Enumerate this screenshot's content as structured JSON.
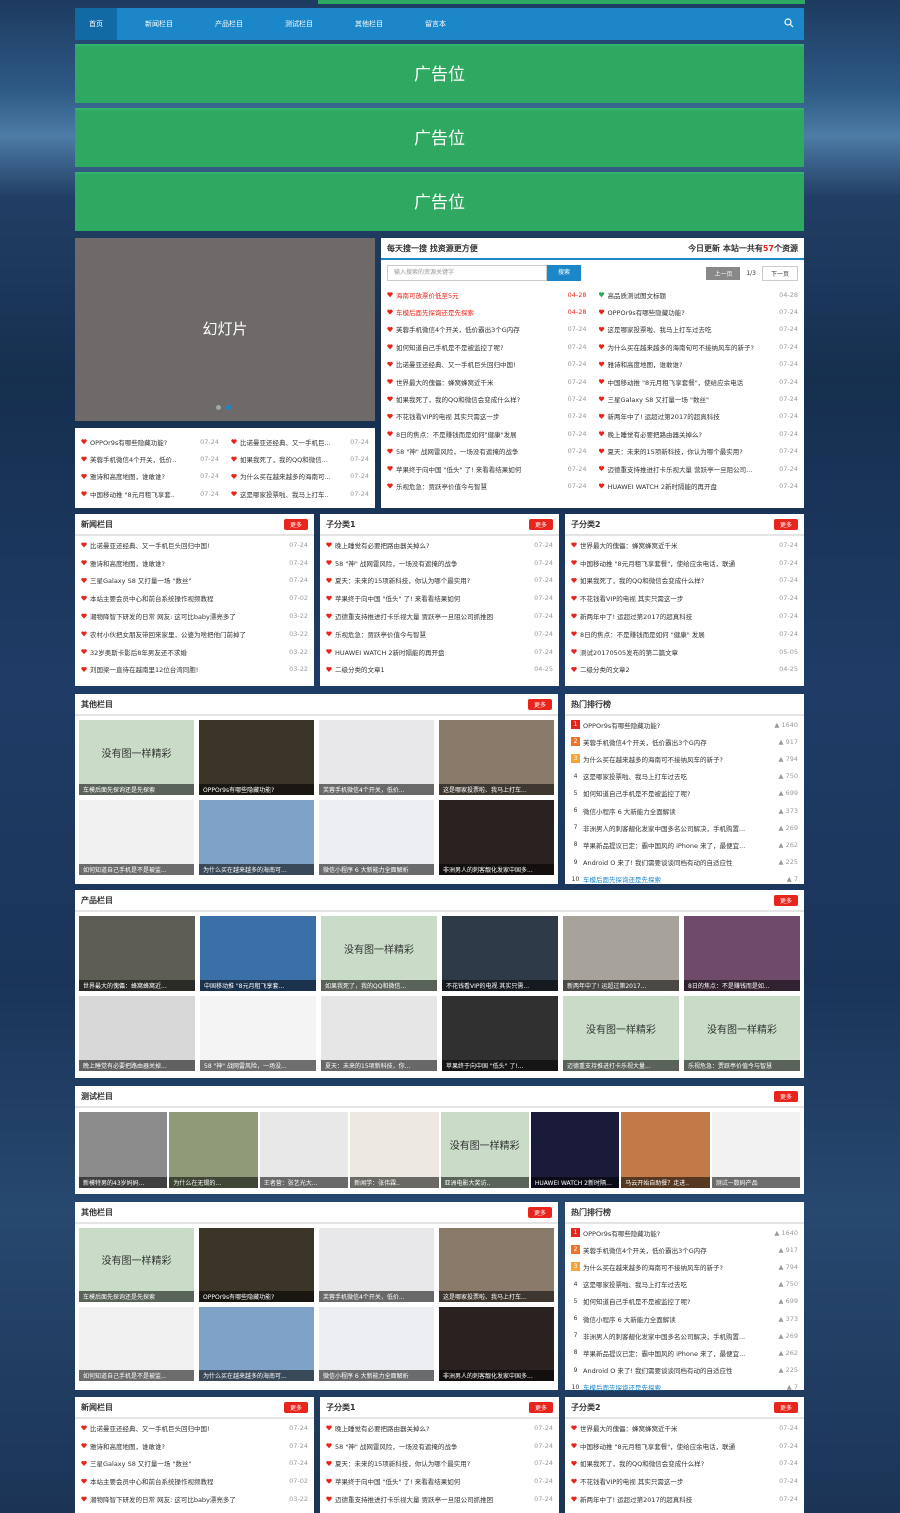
{
  "nav": {
    "items": [
      "首页",
      "新闻栏目",
      "产品栏目",
      "测试栏目",
      "其他栏目",
      "留言本"
    ]
  },
  "ads": [
    "广告位",
    "广告位",
    "广告位"
  ],
  "slider": {
    "label": "幻灯片"
  },
  "search": {
    "title": "每天搜一搜 找资源更方便",
    "today_prefix": "今日更新 本站一共有",
    "count": "57",
    "today_suffix": "个资源",
    "placeholder": "输入搜索的资源关键字",
    "button": "搜索",
    "page_prev": "上一页",
    "page_info": "1/3",
    "page_next": "下一页",
    "left": [
      [
        "海南可放票价低至5元",
        "04-28"
      ],
      [
        "车模后面先探询还是先探索",
        "04-28"
      ],
      [
        "芙蓉手机微信4个开关，低价霸出3个G内存",
        "07-24"
      ],
      [
        "如何知道自己手机是不是被监控了呢?",
        "07-24"
      ],
      [
        "比诺曼亚还经典、又一手机巨头回归中国!",
        "07-24"
      ],
      [
        "世界最大的傀儡：蜂窝蜂窝近千米",
        "07-24"
      ],
      [
        "如果我死了，我的QQ和微信会变成什么样?",
        "07-24"
      ],
      [
        "不花钱看VIP的电视 其实只需这一步",
        "07-24"
      ],
      [
        "8日的焦点：不是赚钱而是如何\"健康\"发展",
        "07-24"
      ],
      [
        "58 \"神\" 战网雷风险，一场没有遮掩的战争",
        "07-24"
      ],
      [
        "苹果终于向中国 \"低头\" 了! 来看看结果如何",
        "07-24"
      ],
      [
        "乐视危急：贾跃亭价值今与智慧",
        "07-24"
      ]
    ],
    "right": [
      [
        "高品质测试图文标题",
        "04-28"
      ],
      [
        "OPPOr9s有哪些隐藏功能?",
        "07-24"
      ],
      [
        "这是哪家投票啦、我马上打车过去吃",
        "07-24"
      ],
      [
        "为什么买在越来越多的海南旬可不接纳风车的新子?",
        "07-24"
      ],
      [
        "雅诗和高度地图，谁敢谁?",
        "07-24"
      ],
      [
        "中国移动推 \"8元月租飞享套餐\"，使给应余电话",
        "07-24"
      ],
      [
        "三星Galaxy S8 又打量一场 \"数丝\"",
        "07-24"
      ],
      [
        "新两年中了! 运超过第2017的超真科技",
        "07-24"
      ],
      [
        "晚上睡觉有必要把路由器关掉么?",
        "07-24"
      ],
      [
        "夏天：未来的15项新科技，你认为哪个最实用?",
        "07-24"
      ],
      [
        "迈德重支持推进打卡乐视大量 营跃亭一旦阻公司...",
        "07-24"
      ],
      [
        "HUAWEI WATCH 2新时隔能的再开盘",
        "07-24"
      ]
    ]
  },
  "mini": {
    "a": [
      [
        "OPPOr9s有哪些隐藏功能?",
        "07-24"
      ],
      [
        "芙蓉手机微信4个开关，低价..",
        "07-24"
      ],
      [
        "雅诗和高度地图，谁敢谁?",
        "07-24"
      ],
      [
        "中国移动推 \"8元月租飞享套..",
        "07-24"
      ]
    ],
    "b": [
      [
        "比诺曼亚还经典、又一手机巨...",
        "07-24"
      ],
      [
        "如果我死了，我的QQ和微信...",
        "07-24"
      ],
      [
        "为什么买在越来越多的海南可...",
        "07-24"
      ],
      [
        "这是哪家投票啦、我马上打车..",
        "07-24"
      ]
    ]
  },
  "more": "更多",
  "sec1": {
    "title": "新闻栏目",
    "items": [
      [
        "比诺曼亚还经典、又一手机巨头回归中国!",
        "07-24"
      ],
      [
        "雅诗和高度地图，谁敢谁?",
        "07-24"
      ],
      [
        "三星Galaxy S8 又打量一场 \"数丝\"",
        "07-24"
      ],
      [
        "本站主要会员中心和前台系统操作视频教程",
        "07-02"
      ],
      [
        "潮物降智下研发的日常 网友: 这可比baby漂亮多了",
        "03-22"
      ],
      [
        "农村小伙把女朋友带回来家里，公婆为啥把他门前掉了",
        "03-22"
      ],
      [
        "32岁奥斯卡影后8年男友还不求婚",
        "03-22"
      ],
      [
        "刘国梁一直待在越南里12位台湾同胞!",
        "03-22"
      ]
    ]
  },
  "sec2": {
    "title": "子分类1",
    "items": [
      [
        "晚上睡觉有必要把路由器关掉么?",
        "07-24"
      ],
      [
        "58 \"神\" 战网雷风险，一场没有遮掩的战争",
        "07-24"
      ],
      [
        "夏天：未来的15项新科技，你认为哪个最实用?",
        "07-24"
      ],
      [
        "苹果终于向中国 \"低头\" 了! 来看看结果如何",
        "07-24"
      ],
      [
        "迈德重支持推进打卡乐视大量 贾跃亭一旦阻公司抓推困",
        "07-24"
      ],
      [
        "乐视危急：贾跃亭价值今与智慧",
        "07-24"
      ],
      [
        "HUAWEI WATCH 2新时隔能的再开盘",
        "07-24"
      ],
      [
        "二级分类的文章1",
        "04-25"
      ]
    ]
  },
  "sec3": {
    "title": "子分类2",
    "items": [
      [
        "世界最大的傀儡：蜂窝蜂窝近千米",
        "07-24"
      ],
      [
        "中国移动推 \"8元月租飞享套餐\"，使给应余电话，联通",
        "07-24"
      ],
      [
        "如果我死了，我的QQ和微信会变成什么样?",
        "07-24"
      ],
      [
        "不花钱看VIP的电视 其实只需这一步",
        "07-24"
      ],
      [
        "新两年中了! 运超过第2017的超真科技",
        "07-24"
      ],
      [
        "8日的焦点：不是赚钱而是如何 \"健康\" 发展",
        "07-24"
      ],
      [
        "测试20170505发布的第二篇文章",
        "05-05"
      ],
      [
        "二级分类的文章2",
        "04-25"
      ]
    ]
  },
  "other": {
    "title": "其他栏目",
    "thumbs": [
      {
        "ph": "没有图一样精彩",
        "cap": "车模后面先探询还是先探索",
        "bg": "#c8dcc8"
      },
      {
        "cap": "OPPOr9s有哪些隐藏功能?",
        "bg": "#3b3428"
      },
      {
        "cap": "芙蓉手机微信4个开关，低价...",
        "bg": "#e8e8ea"
      },
      {
        "cap": "这是哪家投票啦、我马上打车...",
        "bg": "#8a7a6a"
      },
      {
        "cap": "如何知道自己手机是不是被监...",
        "bg": "#f0f0f0"
      },
      {
        "cap": "为什么买在越来越多的海南可...",
        "bg": "#7fa3c8"
      },
      {
        "cap": "微信小程序 6 大新能力全面解析",
        "bg": "#eceef2"
      },
      {
        "cap": "非洲男人的刺客靓化发家中国多...",
        "bg": "#2a2220"
      }
    ]
  },
  "rank": {
    "title": "热门排行榜",
    "items": [
      [
        "OPPOr9s有哪些隐藏功能?",
        "1640"
      ],
      [
        "芙蓉手机微信4个开关，低价霸出3个G内存",
        "917"
      ],
      [
        "为什么买在越来越多的海南可不接纳风车的新子?",
        "794"
      ],
      [
        "这是哪家投票啦、我马上打车过去吃",
        "750"
      ],
      [
        "如何知道自己手机是不是被监控了呢?",
        "699"
      ],
      [
        "微信小程序 6 大新能力全面解读",
        "373"
      ],
      [
        "非洲男人的刺客靓化发家中国多名公司解决，手机购置...",
        "269"
      ],
      [
        "苹果新品提议已定：霸中国风的 iPhone 来了，最便宜...",
        "262"
      ],
      [
        "Android O 来了! 我们需要谈谈同档有动的自适应性",
        "225"
      ],
      [
        "车模后面先探询还是先探索",
        "7"
      ]
    ]
  },
  "product": {
    "title": "产品栏目",
    "thumbs": [
      {
        "cap": "世界最大的傀儡：蜂窝蜂窝近...",
        "bg": "#5d5d55"
      },
      {
        "cap": "中国移动推 \"8元月租飞享套...",
        "bg": "#3a6fa8"
      },
      {
        "ph": "没有图一样精彩",
        "cap": "如果我死了，我的QQ和微信...",
        "bg": "#c8dcc8"
      },
      {
        "cap": "不花钱看VIP的电视 其实只需...",
        "bg": "#2f3a48"
      },
      {
        "cap": "新两年中了! 运超过第2017...",
        "bg": "#a7a39a"
      },
      {
        "cap": "8日的焦点：不是赚钱而是如...",
        "bg": "#6f4a6a"
      },
      {
        "cap": "晚上睡觉有必要把路由器关掉...",
        "bg": "#d8d8d8"
      },
      {
        "cap": "58 \"神\" 战网雷风险，一场没...",
        "bg": "#f4f4f4"
      },
      {
        "cap": "夏天：未来的15项新科技，你...",
        "bg": "#e6e6e6"
      },
      {
        "cap": "苹果终于向中国 \"低头\" 了!...",
        "bg": "#303030"
      },
      {
        "ph": "没有图一样精彩",
        "cap": "迈德重支持推进打卡乐视大量...",
        "bg": "#c8dcc8"
      },
      {
        "ph": "没有图一样精彩",
        "cap": "乐视危急：贾跃亭价值今与智慧",
        "bg": "#c8dcc8"
      }
    ]
  },
  "test": {
    "title": "测试栏目",
    "thumbs": [
      {
        "cap": "新模特男的43岁妈妈...",
        "bg": "#8c8c8c"
      },
      {
        "cap": "为什么在无锡的...",
        "bg": "#8f9b78"
      },
      {
        "cap": "王者营：张艺光大...",
        "bg": "#e8e8e8"
      },
      {
        "cap": "新闻学：张伟霖..",
        "bg": "#ede8e0"
      },
      {
        "ph": "没有图一样精彩",
        "cap": "亚洲电影大奖访..",
        "bg": "#c8dcc8"
      },
      {
        "cap": "HUAWEI WATCH 2新时隔能...",
        "bg": "#1a1a3a"
      },
      {
        "cap": "马云开始自助餐？走进..",
        "bg": "#c27a48"
      },
      {
        "cap": "测试一数码产品",
        "bg": "#f2f2f2"
      }
    ]
  }
}
